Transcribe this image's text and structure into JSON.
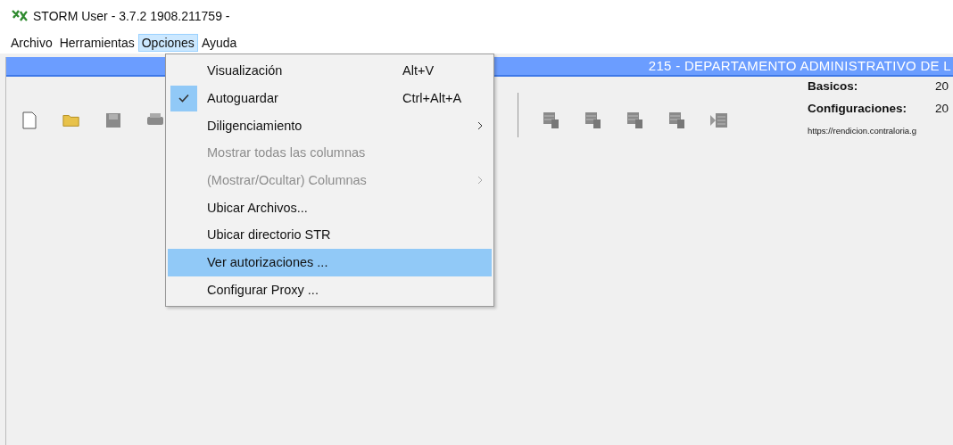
{
  "window": {
    "title": "STORM User - 3.7.2  1908.211759 -"
  },
  "menu_bar": [
    {
      "label": "Archivo",
      "selected": false
    },
    {
      "label": "Herramientas",
      "selected": false
    },
    {
      "label": "Opciones",
      "selected": true
    },
    {
      "label": "Ayuda",
      "selected": false
    }
  ],
  "banner": {
    "title": "215 - DEPARTAMENTO ADMINISTRATIVO DE L"
  },
  "info": [
    {
      "label": "Basicos:",
      "value": "20"
    },
    {
      "label": "Configuraciones:",
      "value": "20"
    }
  ],
  "url": "https://rendicion.contraloria.g",
  "dropdown": [
    {
      "label": "Visualización",
      "shortcut": "Alt+V",
      "checked": false,
      "disabled": false,
      "submenu": false,
      "selected": false
    },
    {
      "label": "Autoguardar",
      "shortcut": "Ctrl+Alt+A",
      "checked": true,
      "disabled": false,
      "submenu": false,
      "selected": false
    },
    {
      "label": "Diligenciamiento",
      "checked": false,
      "disabled": false,
      "submenu": true,
      "selected": false
    },
    {
      "label": "Mostrar todas las columnas",
      "checked": false,
      "disabled": true,
      "submenu": false,
      "selected": false
    },
    {
      "label": "(Mostrar/Ocultar) Columnas",
      "checked": false,
      "disabled": true,
      "submenu": true,
      "selected": false
    },
    {
      "label": "Ubicar Archivos...",
      "checked": false,
      "disabled": false,
      "submenu": false,
      "selected": false
    },
    {
      "label": "Ubicar  directorio STR",
      "checked": false,
      "disabled": false,
      "submenu": false,
      "selected": false
    },
    {
      "label": "Ver autorizaciones ...",
      "checked": false,
      "disabled": false,
      "submenu": false,
      "selected": true
    },
    {
      "label": "Configurar Proxy ...",
      "checked": false,
      "disabled": false,
      "submenu": false,
      "selected": false
    }
  ]
}
